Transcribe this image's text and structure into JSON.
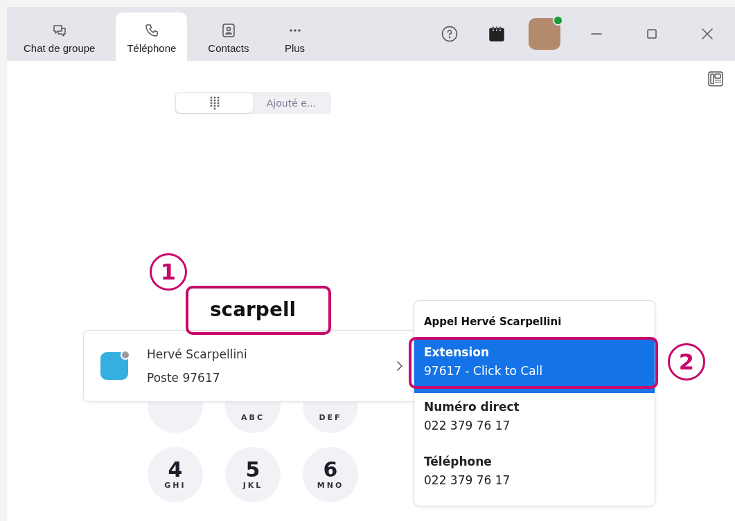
{
  "tabs": [
    {
      "label": "Chat de groupe",
      "selected": false
    },
    {
      "label": "Téléphone",
      "selected": true
    },
    {
      "label": "Contacts",
      "selected": false
    },
    {
      "label": "Plus",
      "selected": false
    }
  ],
  "profile": {
    "online": true
  },
  "segmented": [
    {
      "kind": "keypad",
      "selected": true
    },
    {
      "kind": "text",
      "label": "Ajouté e...",
      "selected": false
    }
  ],
  "dial": {
    "value": "scarpell"
  },
  "keypad": [
    [
      {
        "kind": "partial"
      },
      {
        "kind": "partial",
        "letters": "ABC"
      },
      {
        "kind": "partial",
        "letters": "DEF"
      }
    ],
    [
      {
        "kind": "full",
        "digit": "4",
        "letters": "GHI"
      },
      {
        "kind": "full",
        "digit": "5",
        "letters": "JKL"
      },
      {
        "kind": "full",
        "digit": "6",
        "letters": "MNO"
      }
    ]
  ],
  "result": {
    "name": "Hervé Scarpellini",
    "detail": "Poste 97617"
  },
  "call_menu": {
    "title": "Appel Hervé Scarpellini",
    "options": [
      {
        "label": "Extension",
        "value": "97617 - Click to Call",
        "selected": true
      },
      {
        "label": "Numéro direct",
        "value": "022 379 76 17",
        "selected": false
      },
      {
        "label": "Téléphone",
        "value": "022 379 76 17",
        "selected": false
      }
    ]
  },
  "annotations": [
    {
      "label": "1"
    },
    {
      "label": "2"
    }
  ]
}
